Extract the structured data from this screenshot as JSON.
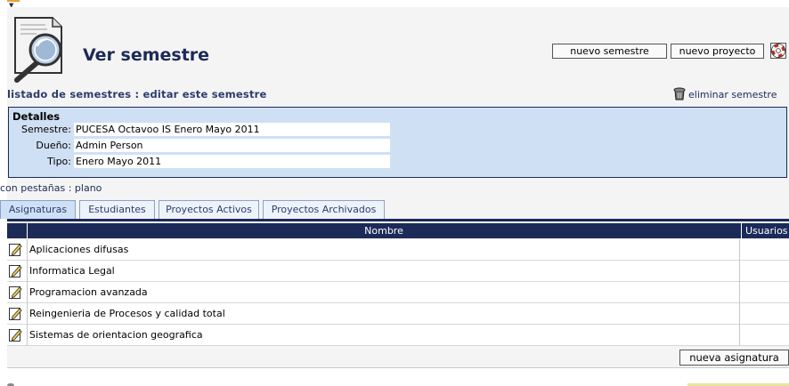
{
  "header": {
    "title": "Ver semestre",
    "buttons": {
      "new_semester": "nuevo semestre",
      "new_project": "nuevo proyecto"
    }
  },
  "breadcrumb": "listado de semestres : editar este semestre",
  "delete_link": "eliminar semestre",
  "details": {
    "title": "Detalles",
    "fields": [
      {
        "label": "Semestre:",
        "value": "PUCESA Octavoo IS Enero Mayo 2011"
      },
      {
        "label": "Dueño:",
        "value": "Admin Person"
      },
      {
        "label": "Tipo:",
        "value": "Enero Mayo 2011"
      }
    ]
  },
  "tabs_label": "con pestañas : plano",
  "tabs": [
    {
      "label": "Asignaturas",
      "active": true
    },
    {
      "label": "Estudiantes",
      "active": false
    },
    {
      "label": "Proyectos Activos",
      "active": false
    },
    {
      "label": "Proyectos Archivados",
      "active": false
    }
  ],
  "table": {
    "columns": [
      "Nombre",
      "Usuarios"
    ],
    "rows": [
      {
        "name": "Aplicaciones difusas",
        "users": ""
      },
      {
        "name": "Informatica Legal",
        "users": ""
      },
      {
        "name": "Programacion avanzada",
        "users": ""
      },
      {
        "name": "Reingenieria de Procesos y calidad total",
        "users": ""
      },
      {
        "name": "Sistemas de orientacion geografica",
        "users": ""
      }
    ]
  },
  "add_subject_button": "nueva asignatura",
  "colors": {
    "navy": "#1c2a58",
    "details_bg": "#cfe0f5",
    "tab_bg": "#eef3fb"
  },
  "icons": [
    "magnifier-logo-icon",
    "lifebuoy-help-icon",
    "trash-can-icon",
    "edit-pencil-icon"
  ]
}
